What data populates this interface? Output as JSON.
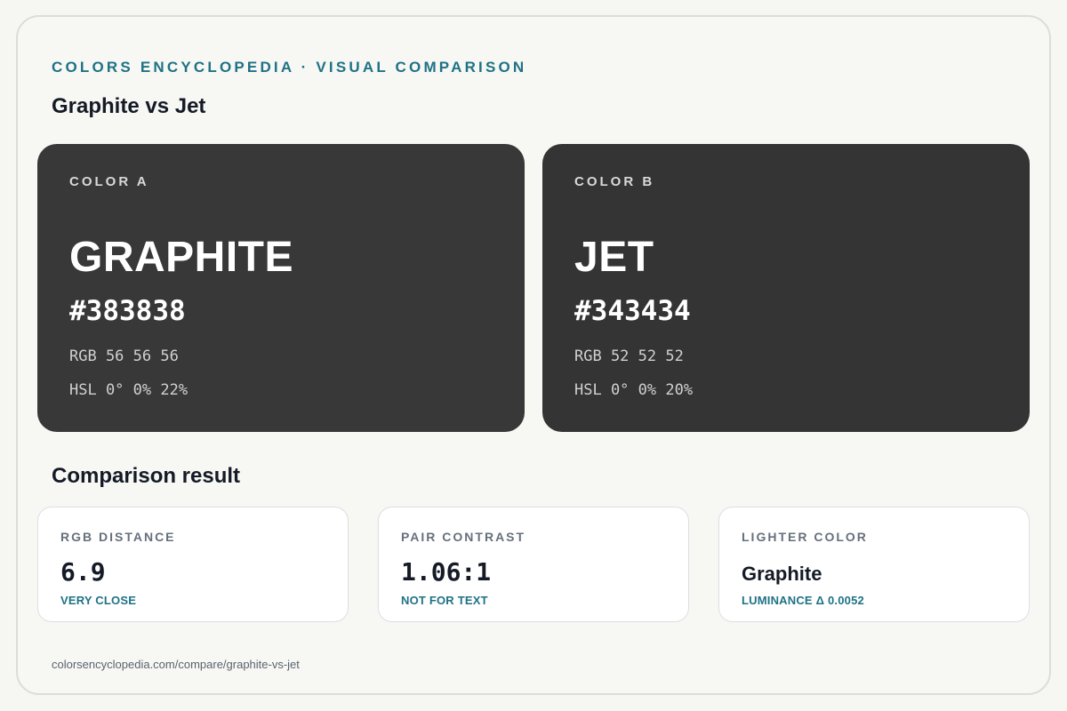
{
  "header": {
    "eyebrow": "COLORS ENCYCLOPEDIA · VISUAL COMPARISON",
    "title": "Graphite vs Jet"
  },
  "colors": {
    "a": {
      "label": "COLOR A",
      "name": "GRAPHITE",
      "hex": "#383838",
      "rgb": "RGB 56 56 56",
      "hsl": "HSL 0° 0% 22%",
      "swatch_color": "#383838"
    },
    "b": {
      "label": "COLOR B",
      "name": "JET",
      "hex": "#343434",
      "rgb": "RGB 52 52 52",
      "hsl": "HSL 0° 0% 20%",
      "swatch_color": "#343434"
    }
  },
  "comparison": {
    "title": "Comparison result",
    "stats": [
      {
        "label": "RGB DISTANCE",
        "value": "6.9",
        "note": "VERY CLOSE"
      },
      {
        "label": "PAIR CONTRAST",
        "value": "1.06:1",
        "note": "NOT FOR TEXT"
      },
      {
        "label": "LIGHTER COLOR",
        "value": "Graphite",
        "note": "LUMINANCE Δ 0.0052"
      }
    ]
  },
  "footer": {
    "url": "colorsencyclopedia.com/compare/graphite-vs-jet"
  },
  "theme": {
    "accent": "#1e7285",
    "background": "#f6f6f2"
  }
}
